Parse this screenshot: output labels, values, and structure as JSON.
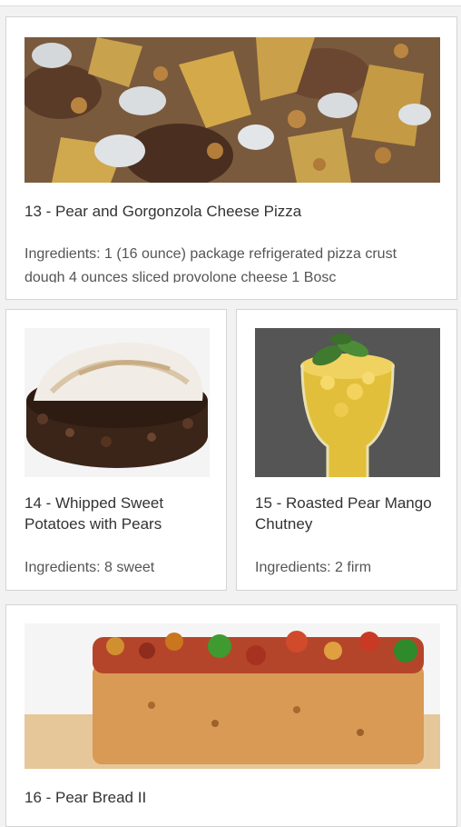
{
  "recipes": [
    {
      "title": "13 - Pear and Gorgonzola Cheese Pizza",
      "ingredients": "Ingredients: 1 (16 ounce) package refrigerated pizza crust dough 4 ounces sliced provolone cheese 1 Bosc",
      "image_icon": "pizza-photo"
    },
    {
      "title": "14 - Whipped Sweet Potatoes with Pears",
      "ingredients": "Ingredients:  8 sweet",
      "image_icon": "meringue-pie-photo"
    },
    {
      "title": "15 - Roasted Pear Mango Chutney",
      "ingredients": "Ingredients:  2 firm",
      "image_icon": "chutney-glass-photo"
    },
    {
      "title": "16 - Pear Bread II",
      "image_icon": "fruit-bread-photo"
    }
  ]
}
